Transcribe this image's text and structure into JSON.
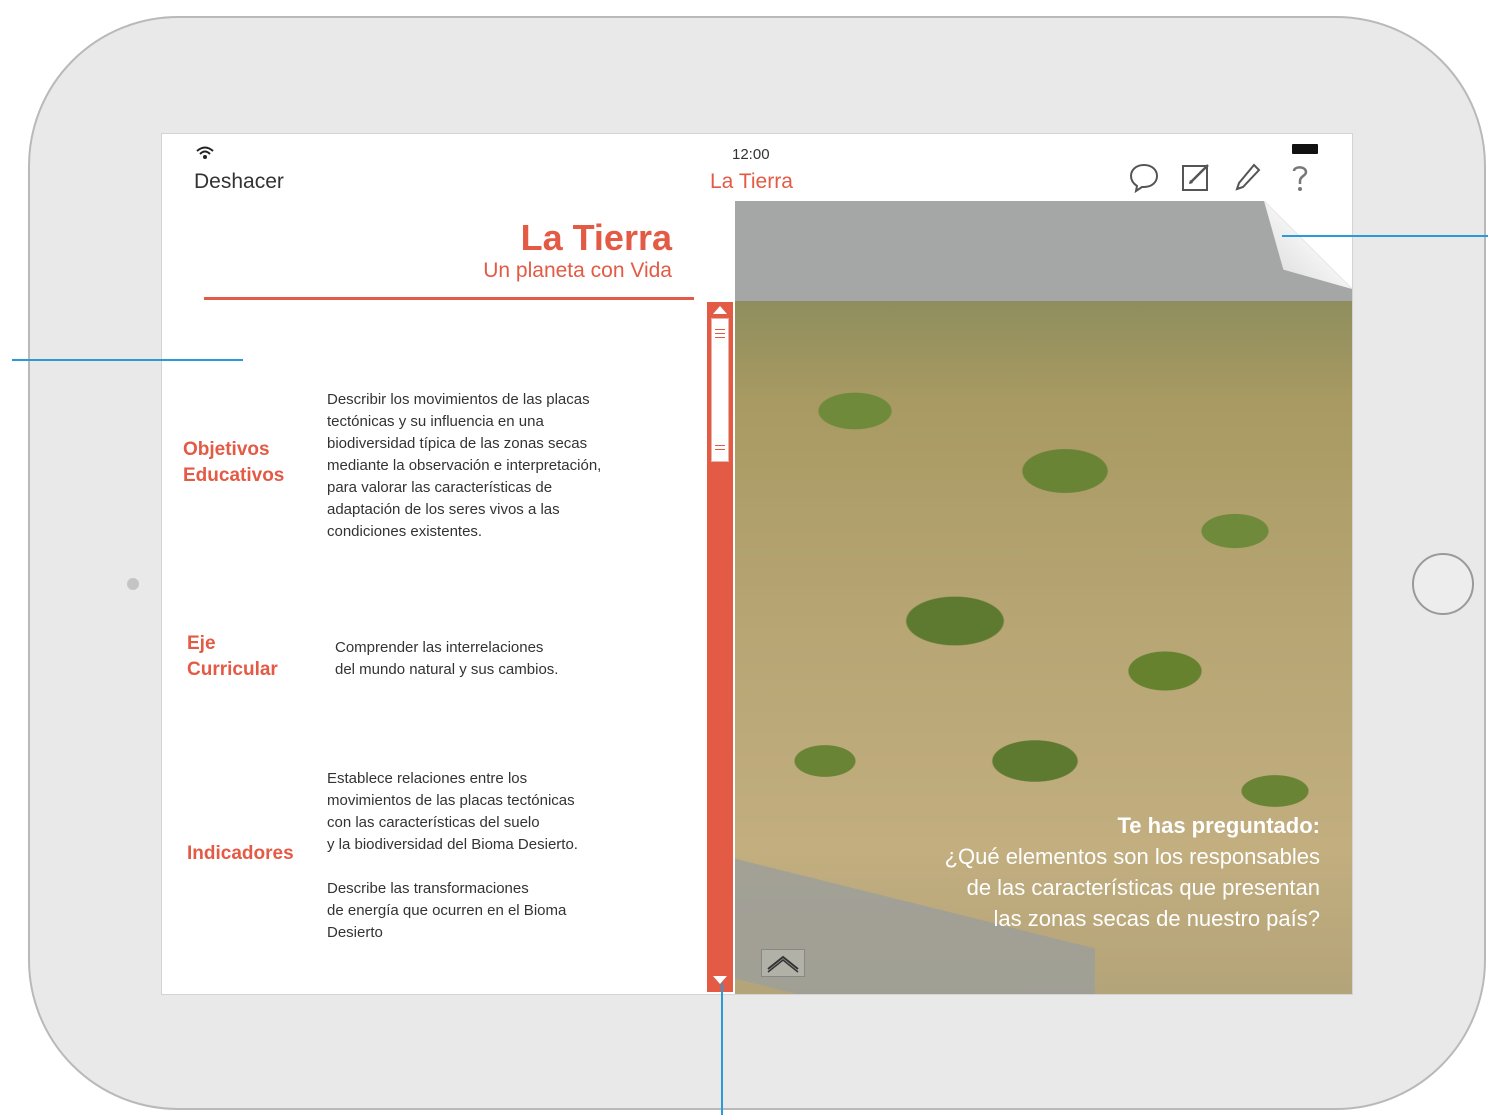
{
  "status_bar": {
    "time": "12:00"
  },
  "nav": {
    "undo_label": "Deshacer",
    "title": "La Tierra",
    "tools": [
      {
        "icon": "comment-icon"
      },
      {
        "icon": "edit-icon"
      },
      {
        "icon": "pencil-icon"
      },
      {
        "icon": "help-icon"
      }
    ]
  },
  "lesson": {
    "title": "La Tierra",
    "subtitle": "Un planeta con Vida",
    "sections": [
      {
        "label": [
          "Objetivos",
          "Educativos"
        ],
        "text": [
          "Describir los movimientos de las placas",
          "tectónicas y su influencia en una",
          "biodiversidad típica de las zonas secas",
          "mediante la observación e interpretación,",
          "para valorar las características de",
          "adaptación de los seres vivos a las",
          "condiciones existentes."
        ]
      },
      {
        "label": [
          "Eje",
          "Curricular"
        ],
        "text": [
          "Comprender las interrelaciones",
          "del mundo natural y sus cambios."
        ]
      },
      {
        "label": [
          "Indicadores"
        ],
        "text": [
          "Establece relaciones entre los",
          "movimientos de las placas tectónicas",
          "con las características del suelo",
          "y la biodiversidad del Bioma Desierto."
        ],
        "text2": [
          "Describe las transformaciones",
          "de energía que ocurren en el Bioma",
          "Desierto"
        ]
      }
    ]
  },
  "photo": {
    "question_title": "Te has preguntado:",
    "question_lines": [
      "¿Qué elementos son los responsables",
      "de las características que presentan",
      "las zonas secas de nuestro país?"
    ]
  },
  "colors": {
    "accent": "#e35a45",
    "callout": "#2a9bd8"
  }
}
